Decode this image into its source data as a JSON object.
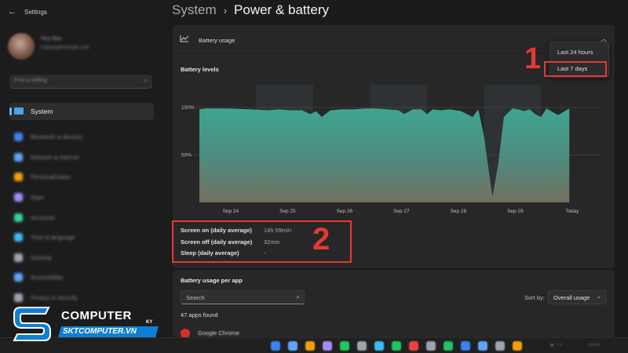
{
  "window": {
    "title": "Settings",
    "back_icon": "back-arrow-icon"
  },
  "user": {
    "name": "Huy Bao",
    "email": "huybao@example.com"
  },
  "sidebar": {
    "search_placeholder": "Find a setting",
    "selected": "System",
    "items": [
      {
        "label": "Bluetooth & devices",
        "color": "#3b82f6"
      },
      {
        "label": "Network & internet",
        "color": "#60a5fa"
      },
      {
        "label": "Personalization",
        "color": "#f59e0b"
      },
      {
        "label": "Apps",
        "color": "#a78bfa"
      },
      {
        "label": "Accounts",
        "color": "#34d399"
      },
      {
        "label": "Time & language",
        "color": "#38bdf8"
      },
      {
        "label": "Gaming",
        "color": "#9ca3af"
      },
      {
        "label": "Accessibility",
        "color": "#60a5fa"
      },
      {
        "label": "Privacy & security",
        "color": "#9ca3af"
      }
    ]
  },
  "breadcrumb": {
    "parent": "System",
    "separator": "›",
    "current": "Power & battery"
  },
  "battery_usage": {
    "title": "Battery usage",
    "levels_title": "Battery levels",
    "dropdown": {
      "options": [
        "Last 24 hours",
        "Last 7 days"
      ],
      "selected": "Last 7 days"
    }
  },
  "annotations": {
    "one": "1",
    "two": "2",
    "color": "#e53935"
  },
  "stats": [
    {
      "label": "Screen on (daily average)",
      "value": "14h 59min"
    },
    {
      "label": "Screen off (daily average)",
      "value": "32min"
    },
    {
      "label": "Sleep (daily average)",
      "value": "-"
    }
  ],
  "per_app": {
    "title": "Battery usage per app",
    "search_placeholder": "Search",
    "sort_label": "Sort by:",
    "sort_value": "Overall usage",
    "apps_found": "47 apps found",
    "first_app": "Google Chrome"
  },
  "logo": {
    "name": "COMPUTER",
    "suffix": "KY",
    "site": "SKTCOMPUTER.VN"
  },
  "chart_data": {
    "type": "area",
    "title": "Battery levels",
    "xlabel": "",
    "ylabel": "",
    "x_ticks": [
      "Sep 24",
      "Sep 25",
      "Sep 26",
      "Sep 27",
      "Sep 28",
      "Sep 29",
      "Today"
    ],
    "y_ticks": [
      "100%",
      "50%"
    ],
    "ylim": [
      0,
      100
    ],
    "x_range": [
      0,
      6.6
    ],
    "grid": true,
    "shaded_days": [
      1,
      3,
      5
    ],
    "series": [
      {
        "x": [
          0,
          0.1,
          0.5,
          0.9,
          1.2,
          1.4,
          1.6,
          1.8,
          1.95,
          2.05,
          2.15,
          2.3,
          2.5,
          2.7,
          2.9,
          3.1,
          3.3,
          3.5,
          3.6,
          3.75,
          3.9,
          4.0,
          4.1,
          4.25,
          4.4,
          4.6,
          4.8,
          4.9,
          5.0,
          5.08,
          5.15,
          5.25,
          5.35,
          5.5,
          5.6,
          5.7,
          5.8,
          5.9,
          6.0,
          6.1,
          6.3,
          6.5
        ],
        "y": [
          98,
          99,
          99,
          98,
          97,
          98,
          97,
          97,
          93,
          96,
          90,
          97,
          98,
          98,
          99,
          99,
          98,
          97,
          93,
          98,
          98,
          93,
          98,
          97,
          98,
          96,
          90,
          98,
          70,
          35,
          6,
          40,
          90,
          99,
          98,
          96,
          98,
          93,
          90,
          99,
          92,
          99
        ]
      }
    ]
  },
  "taskbar": {
    "icons": [
      "#3b82f6",
      "#60a5fa",
      "#f59e0b",
      "#a78bfa",
      "#22c55e",
      "#9ca3af",
      "#38bdf8",
      "#22c55e",
      "#ef4444",
      "#9ca3af",
      "#22c55e",
      "#3b82f6",
      "#60a5fa",
      "#9ca3af",
      "#f59e0b"
    ]
  }
}
